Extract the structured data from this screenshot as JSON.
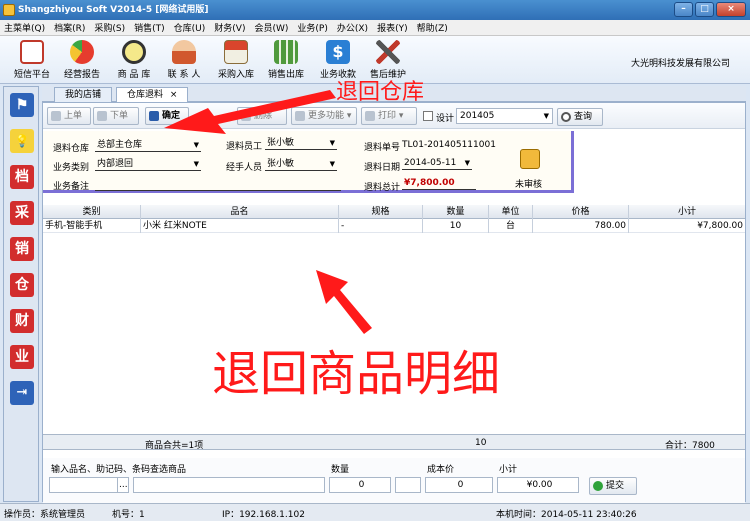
{
  "window": {
    "title": "Shangzhiyou Soft V2014-5 [网络试用版]",
    "minimize_glyph": "–",
    "maximize_glyph": "□",
    "close_glyph": "×"
  },
  "menu": [
    "主菜单(Q)",
    "档案(R)",
    "采购(S)",
    "销售(T)",
    "仓库(U)",
    "财务(V)",
    "会员(W)",
    "业务(P)",
    "办公(X)",
    "报表(Y)",
    "帮助(Z)"
  ],
  "toolbar": {
    "items": [
      {
        "label": "短信平台",
        "icon": "envelope-icon"
      },
      {
        "label": "经营报告",
        "icon": "pie-chart-icon"
      },
      {
        "label": "商 品 库",
        "icon": "magnifier-icon"
      },
      {
        "label": "联 系 人",
        "icon": "person-icon"
      },
      {
        "label": "采购入库",
        "icon": "house-icon"
      },
      {
        "label": "销售出库",
        "icon": "grid-icon"
      },
      {
        "label": "业务收款",
        "icon": "dollar-icon"
      },
      {
        "label": "售后维护",
        "icon": "tools-icon"
      }
    ],
    "company": "大光明科技发展有限公司"
  },
  "sidebar": [
    {
      "icon": "flag-icon",
      "glyph": "⚑"
    },
    {
      "icon": "bulb-icon",
      "glyph": "💡"
    },
    {
      "icon": "archive-icon",
      "glyph": "档"
    },
    {
      "icon": "purchase-icon",
      "glyph": "采"
    },
    {
      "icon": "sales-icon",
      "glyph": "销"
    },
    {
      "icon": "warehouse-icon",
      "glyph": "仓"
    },
    {
      "icon": "finance-icon",
      "glyph": "财"
    },
    {
      "icon": "business-icon",
      "glyph": "业"
    },
    {
      "icon": "exit-icon",
      "glyph": "⇥"
    }
  ],
  "tabs": [
    {
      "label": "我的店铺"
    },
    {
      "label": "仓库退料",
      "close": "×"
    }
  ],
  "actions": {
    "prev": "上单",
    "next": "下单",
    "confirm": "确定",
    "delete": "删除",
    "more": "更多功能",
    "print": "打印",
    "design": "设计",
    "period": "201405",
    "query": "查询"
  },
  "form": {
    "warehouse_label": "退料仓库",
    "warehouse_value": "总部主仓库",
    "staff_label": "退料员工",
    "staff_value": "张小敏",
    "doc_no_label": "退料单号",
    "doc_no_value": "TL01-201405111001",
    "biz_type_label": "业务类别",
    "biz_type_value": "内部退回",
    "handler_label": "经手人员",
    "handler_value": "张小敏",
    "date_label": "退料日期",
    "date_value": "2014-05-11",
    "remark_label": "业务备注",
    "remark_value": "",
    "total_label": "退料总计",
    "total_value": "¥7,800.00",
    "audit_label": "未审核"
  },
  "grid": {
    "columns": [
      "类别",
      "品名",
      "规格",
      "数量",
      "单位",
      "价格",
      "小计"
    ],
    "rows": [
      {
        "category": "手机-智能手机",
        "name": "小米 红米NOTE",
        "spec": "-",
        "qty": "10",
        "unit": "台",
        "price": "780.00",
        "subtotal": "¥7,800.00"
      }
    ],
    "footer": {
      "count": "商品合共=1项",
      "qty": "10",
      "total": "合计：7800"
    }
  },
  "entry": {
    "search_label": "输入品名、助记码、条码查选商品",
    "browse": "...",
    "qty_label": "数量",
    "qty_value": "0",
    "cost_label": "成本价",
    "cost_value": "0",
    "subtotal_label": "小计",
    "subtotal_value": "¥0.00",
    "submit": "提交"
  },
  "status": {
    "operator": "操作员：系统管理员",
    "machine": "机号：1",
    "ip": "IP：192.168.1.102",
    "time": "本机时间：2014-05-11 23:40:26"
  },
  "annotations": {
    "return_warehouse": "退回仓库",
    "return_details": "退回商品明细"
  }
}
